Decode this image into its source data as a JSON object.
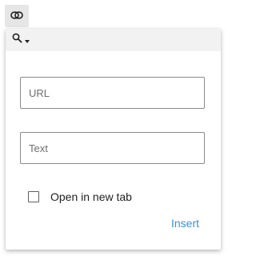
{
  "toolbar": {
    "link_icon": "link-icon"
  },
  "popover": {
    "header": {
      "search_icon": "search-icon",
      "dropdown_icon": "caret-down-icon"
    },
    "url_field": {
      "placeholder": "URL",
      "value": ""
    },
    "text_field": {
      "placeholder": "Text",
      "value": ""
    },
    "open_new_tab": {
      "label": "Open in new tab",
      "checked": false
    },
    "insert_label": "Insert"
  },
  "colors": {
    "accent": "#3d8fd6",
    "toolbar_button_bg": "#e6e6e6",
    "header_bg": "#f2f2f2",
    "field_border": "#8a8a8a"
  }
}
